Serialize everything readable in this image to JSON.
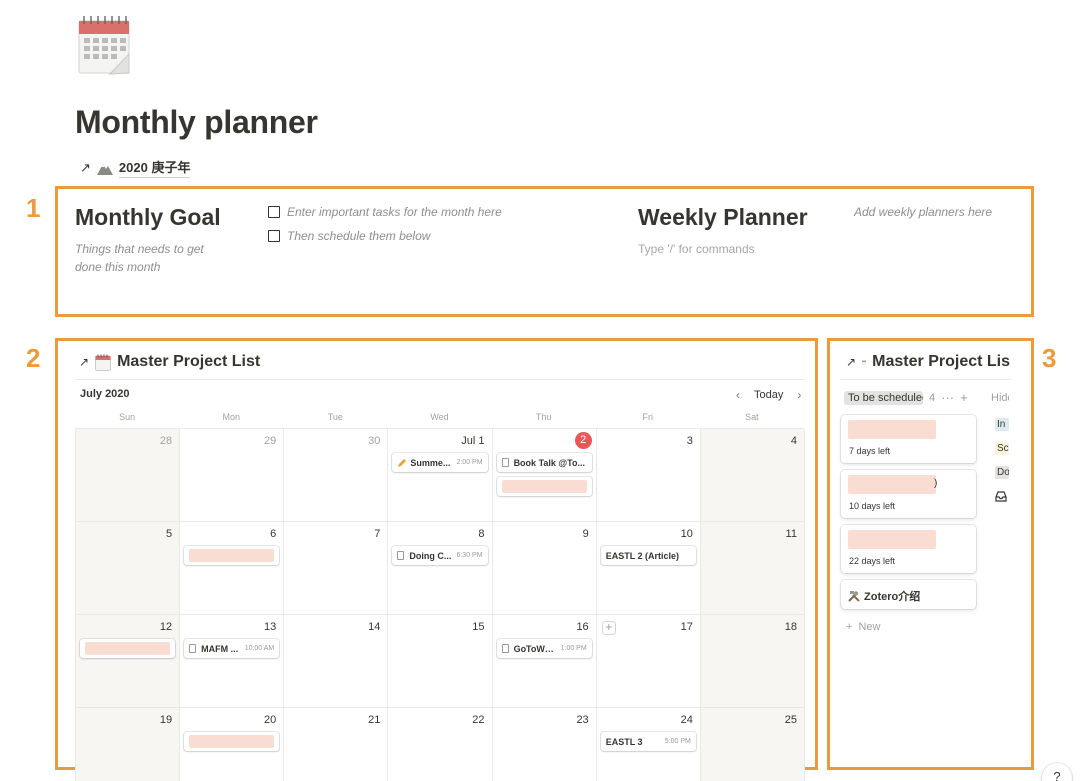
{
  "page": {
    "icon": "tear-off-calendar-icon",
    "title": "Monthly planner",
    "link_text": "2020 庚子年",
    "link_icon": "mountain-icon"
  },
  "markers": {
    "one": "1",
    "two": "2",
    "three": "3"
  },
  "accent_color": "#ec9a3b",
  "section1": {
    "goal_heading": "Monthly Goal",
    "goal_sub": "Things that needs to get done this month",
    "todos": [
      {
        "label": "Enter important tasks for the month here",
        "checked": false
      },
      {
        "label": "Then schedule them below",
        "checked": false
      }
    ],
    "weekly_heading": "Weekly Planner",
    "weekly_placeholder": "Type '/' for commands",
    "weekly_hint": "Add weekly planners here"
  },
  "calendar": {
    "db_title": "Master Project List",
    "month": "July 2020",
    "today_label": "Today",
    "weekdays": [
      "Sun",
      "Mon",
      "Tue",
      "Wed",
      "Thu",
      "Fri",
      "Sat"
    ],
    "today_color": "#eb5757",
    "days": [
      {
        "label": "28",
        "muted": true,
        "weekend": true
      },
      {
        "label": "29",
        "muted": true
      },
      {
        "label": "30",
        "muted": true
      },
      {
        "label": "Jul 1",
        "events": [
          {
            "title": "Summe...",
            "time": "2:00 PM",
            "icon": "pencil-icon"
          }
        ]
      },
      {
        "label": "2",
        "today": true,
        "events": [
          {
            "title": "Book Talk @To...",
            "time": "",
            "icon": "doc-icon"
          },
          {
            "redacted": true
          }
        ]
      },
      {
        "label": "3"
      },
      {
        "label": "4",
        "weekend": true
      },
      {
        "label": "5",
        "weekend": true
      },
      {
        "label": "6",
        "events": [
          {
            "redacted": true
          }
        ]
      },
      {
        "label": "7"
      },
      {
        "label": "8",
        "events": [
          {
            "title": "Doing C...",
            "time": "6:30 PM",
            "icon": "doc-icon"
          }
        ]
      },
      {
        "label": "9"
      },
      {
        "label": "10",
        "events": [
          {
            "title": "EASTL 2 (Article)",
            "time": ""
          }
        ]
      },
      {
        "label": "11",
        "weekend": true
      },
      {
        "label": "12",
        "weekend": true,
        "events": [
          {
            "redacted": true
          }
        ]
      },
      {
        "label": "13",
        "events": [
          {
            "title": "MAFM ...",
            "time": "10:00 AM",
            "icon": "doc-icon"
          }
        ]
      },
      {
        "label": "14"
      },
      {
        "label": "15"
      },
      {
        "label": "16",
        "events": [
          {
            "title": "GoToWe...",
            "time": "1:00 PM",
            "icon": "doc-icon"
          }
        ]
      },
      {
        "label": "17",
        "plus": true
      },
      {
        "label": "18",
        "weekend": true
      },
      {
        "label": "19",
        "weekend": true
      },
      {
        "label": "20",
        "events": [
          {
            "redacted": true
          }
        ]
      },
      {
        "label": "21"
      },
      {
        "label": "22"
      },
      {
        "label": "23"
      },
      {
        "label": "24",
        "events": [
          {
            "title": "EASTL 3",
            "time": "5:00 PM"
          }
        ]
      },
      {
        "label": "25",
        "weekend": true
      }
    ]
  },
  "board": {
    "db_title": "Master Project Lis",
    "group_label": "To be scheduled",
    "group_count": "4",
    "hidden_label": "Hidd",
    "cards": [
      {
        "days_left": "7 days left",
        "redacted": true
      },
      {
        "days_left": "10 days left",
        "redacted": true,
        "suffix": ")"
      },
      {
        "days_left": "22 days left",
        "redacted": true
      },
      {
        "title": "Zotero介绍",
        "icon": "tools-icon"
      }
    ],
    "new_label": "New",
    "side_tags": [
      {
        "label": "In",
        "color": "#ddebf1"
      },
      {
        "label": "Sc",
        "color": "#fbf3db"
      },
      {
        "label": "Do",
        "color": "#e3e2e0"
      }
    ]
  },
  "help_label": "?"
}
